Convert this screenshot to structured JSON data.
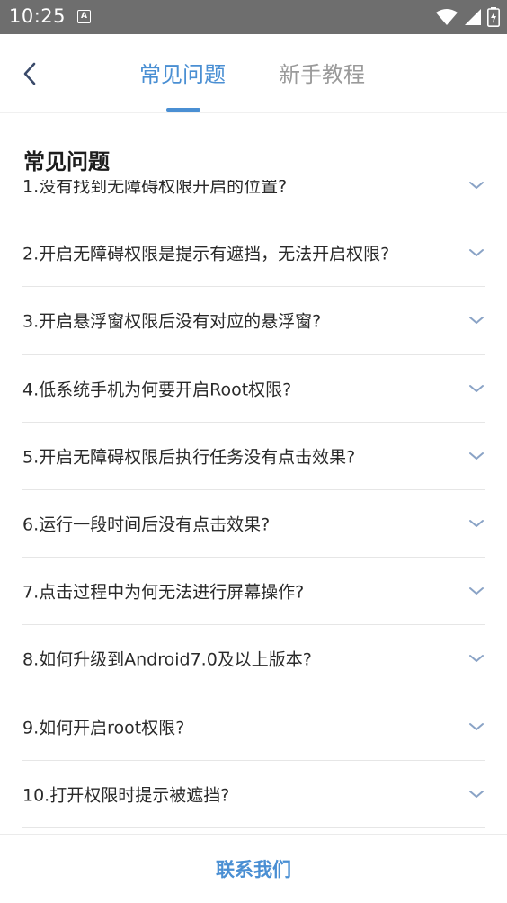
{
  "status_bar": {
    "time": "10:25",
    "notification_badge": "A"
  },
  "header": {
    "tabs": [
      {
        "label": "常见问题",
        "active": true
      },
      {
        "label": "新手教程",
        "active": false
      }
    ],
    "accent_color": "#4a8fd3"
  },
  "section": {
    "title": "常见问题"
  },
  "faq_items": [
    {
      "label": "1.没有找到无障碍权限开启的位置?"
    },
    {
      "label": "2.开启无障碍权限是提示有遮挡，无法开启权限?"
    },
    {
      "label": "3.开启悬浮窗权限后没有对应的悬浮窗?"
    },
    {
      "label": "4.低系统手机为何要开启Root权限?"
    },
    {
      "label": "5.开启无障碍权限后执行任务没有点击效果?"
    },
    {
      "label": "6.运行一段时间后没有点击效果?"
    },
    {
      "label": "7.点击过程中为何无法进行屏幕操作?"
    },
    {
      "label": "8.如何升级到Android7.0及以上版本?"
    },
    {
      "label": "9.如何开启root权限?"
    },
    {
      "label": "10.打开权限时提示被遮挡?"
    }
  ],
  "bottom": {
    "contact_label": "联系我们"
  }
}
